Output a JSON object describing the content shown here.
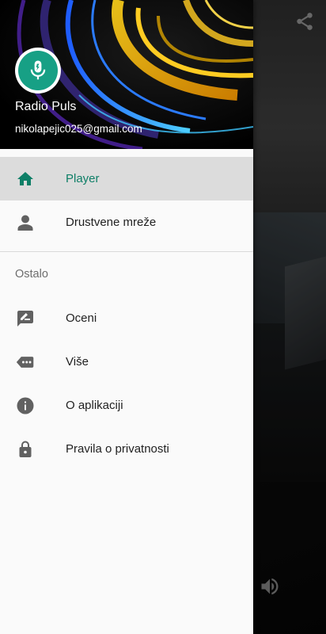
{
  "drawer": {
    "header": {
      "app_name": "Radio Puls",
      "email": "nikolapejic025@gmail.com"
    },
    "primary_items": [
      {
        "label": "Player",
        "icon": "home-icon",
        "active": true
      },
      {
        "label": "Drustvene mreže",
        "icon": "person-icon",
        "active": false
      }
    ],
    "section_title": "Ostalo",
    "secondary_items": [
      {
        "label": "Oceni",
        "icon": "rate-edit-icon"
      },
      {
        "label": "Više",
        "icon": "more-label-icon"
      },
      {
        "label": "O aplikaciji",
        "icon": "info-icon"
      },
      {
        "label": "Pravila o privatnosti",
        "icon": "lock-icon"
      }
    ]
  },
  "background_app": {
    "icons": [
      "share-icon",
      "volume-icon"
    ]
  },
  "colors": {
    "accent": "#0e7f67",
    "avatar_bg": "#17a085",
    "active_item_bg": "#dcdcdc",
    "icon_gray": "#616161"
  }
}
